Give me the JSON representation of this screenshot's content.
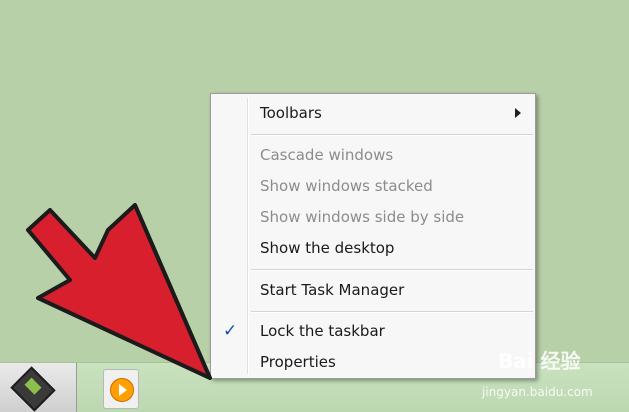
{
  "menu": {
    "items": [
      {
        "label": "Toolbars",
        "enabled": true,
        "submenu": true
      },
      {
        "label": "Cascade windows",
        "enabled": false
      },
      {
        "label": "Show windows stacked",
        "enabled": false
      },
      {
        "label": "Show windows side by side",
        "enabled": false
      },
      {
        "label": "Show the desktop",
        "enabled": true
      },
      {
        "label": "Start Task Manager",
        "enabled": true
      },
      {
        "label": "Lock the taskbar",
        "enabled": true,
        "checked": true
      },
      {
        "label": "Properties",
        "enabled": true
      }
    ]
  },
  "icons": {
    "checkmark": "✓"
  },
  "watermark": {
    "logo": "Bai 经验",
    "url": "jingyan.baidu.com"
  },
  "colors": {
    "desktop": "#b8d0a8",
    "arrow": "#d81f2e",
    "checkmark": "#1750b0"
  }
}
